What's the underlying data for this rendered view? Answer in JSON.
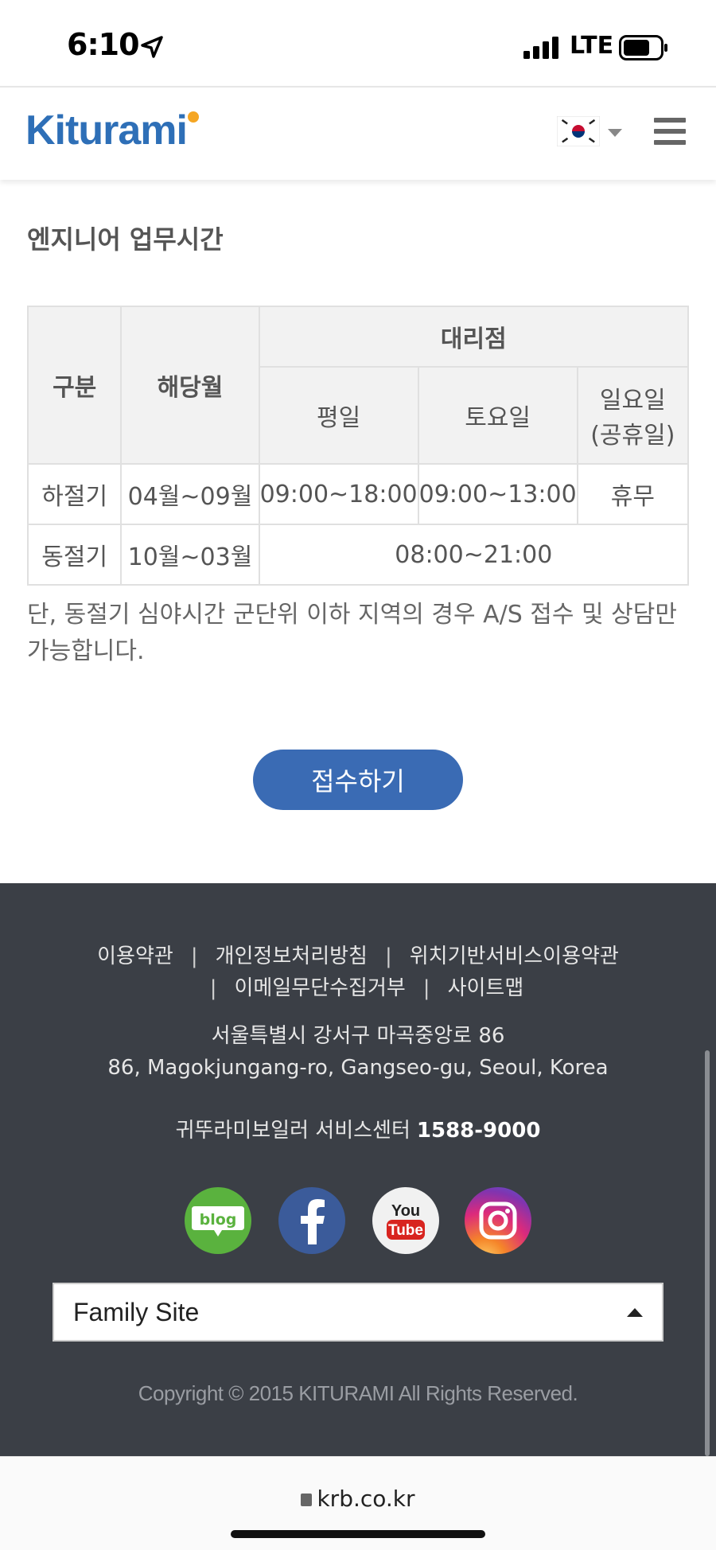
{
  "status_bar": {
    "time": "6:10",
    "network": "LTE"
  },
  "header": {
    "logo": "Kiturami",
    "language": "Korean"
  },
  "content": {
    "title": "엔지니어 업무시간",
    "table": {
      "col_gubun": "구분",
      "col_month": "해당월",
      "col_agency": "대리점",
      "col_weekday": "평일",
      "col_saturday": "토요일",
      "col_sunday_line1": "일요일",
      "col_sunday_line2": "(공휴일)",
      "rows": [
        {
          "season": "하절기",
          "months": "04월~09월",
          "weekday": "09:00~18:00",
          "saturday": "09:00~13:00",
          "sunday": "휴무"
        },
        {
          "season": "동절기",
          "months": "10월~03월",
          "all": "08:00~21:00"
        }
      ]
    },
    "notice": "단, 동절기 심야시간 군단위 이하 지역의 경우 A/S 접수 및 상담만 가능합니다.",
    "submit_button": "접수하기"
  },
  "footer": {
    "links": [
      "이용약관",
      "개인정보처리방침",
      "위치기반서비스이용약관",
      "이메일무단수집거부",
      "사이트맵"
    ],
    "address_ko": "서울특별시 강서구 마곡중앙로 86",
    "address_en": "86, Magokjungang-ro, Gangseo-gu, Seoul, Korea",
    "service_label": "귀뚜라미보일러 서비스센터",
    "service_number": "1588-9000",
    "social": {
      "blog": "blog",
      "youtube_top": "You",
      "youtube_bottom": "Tube"
    },
    "family_site": "Family Site",
    "copyright": "Copyright © 2015 KITURAMI All Rights Reserved."
  },
  "browser": {
    "url": "krb.co.kr"
  },
  "colors": {
    "brand_blue": "#2e6fb7",
    "button_blue": "#3a6bb4",
    "footer_bg": "#3b3f46"
  }
}
